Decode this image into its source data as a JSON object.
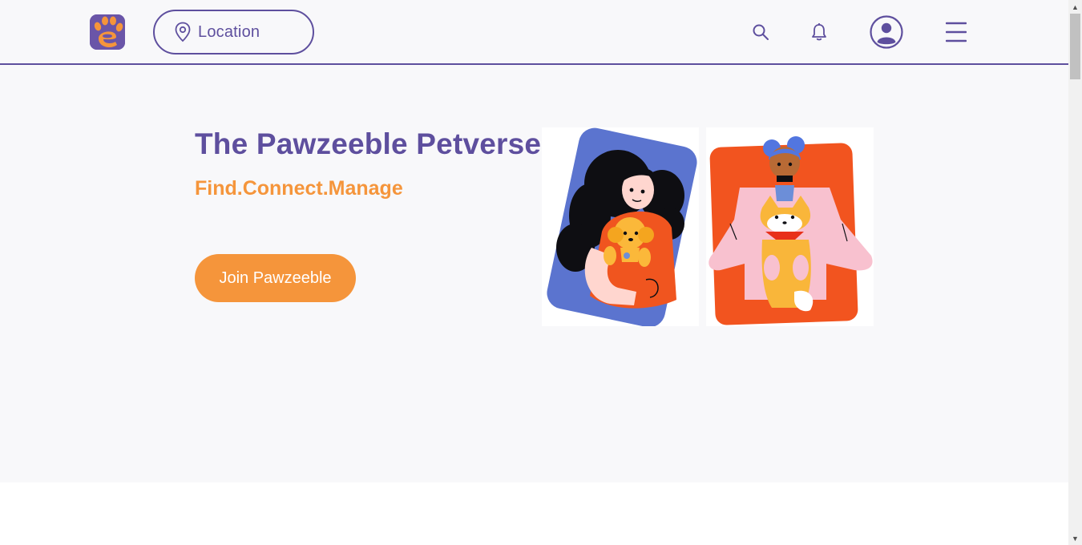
{
  "header": {
    "logo_icon": "paw-logo-icon",
    "location": {
      "label": "Location",
      "icon": "map-pin-icon"
    },
    "icons": [
      "search-icon",
      "bell-icon",
      "user-avatar-icon",
      "hamburger-menu-icon"
    ]
  },
  "hero": {
    "title": "The Pawzeeble Petverse",
    "subtitle": "Find.Connect.Manage",
    "join_button": "Join Pawzeeble"
  },
  "colors": {
    "brand_purple": "#5e4f9e",
    "accent_orange": "#f5953b",
    "hero_background": "#f8f8fa"
  }
}
